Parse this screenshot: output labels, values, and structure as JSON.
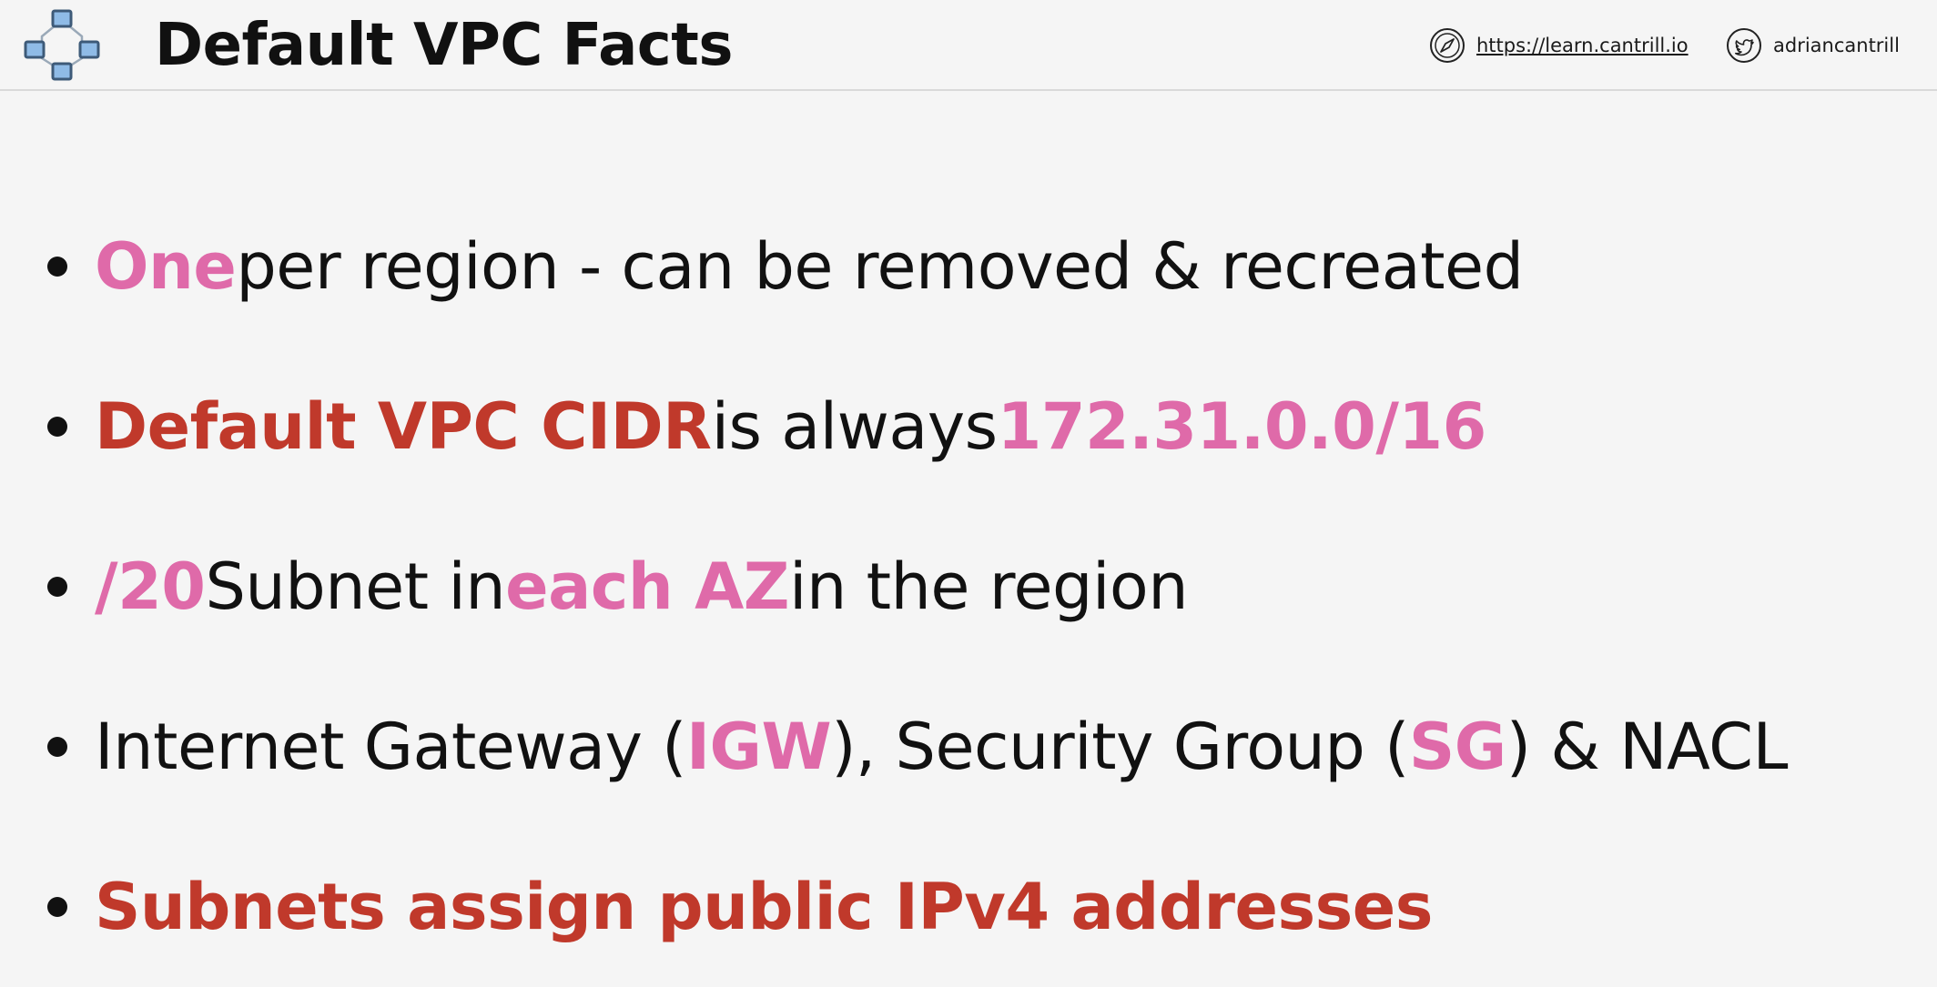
{
  "header": {
    "title": "Default VPC Facts",
    "logo_icon": "network-nodes-icon",
    "site_icon": "compass-icon",
    "site_link": "https://learn.cantrill.io",
    "twitter_icon": "twitter-bird-icon",
    "twitter_handle": "adriancantrill"
  },
  "colors": {
    "highlight_pink": "#df6aa9",
    "highlight_red": "#c0392b",
    "text": "#111111",
    "background": "#f5f5f5"
  },
  "bullets": [
    {
      "parts": [
        {
          "text": "One",
          "style": "pink"
        },
        {
          "text": " per region - can be removed & recreated",
          "style": "plain"
        }
      ]
    },
    {
      "parts": [
        {
          "text": "Default VPC CIDR",
          "style": "red"
        },
        {
          "text": " is always ",
          "style": "plain"
        },
        {
          "text": "172.31.0.0/16",
          "style": "pink"
        }
      ]
    },
    {
      "parts": [
        {
          "text": "/20",
          "style": "pink"
        },
        {
          "text": " Subnet in ",
          "style": "plain"
        },
        {
          "text": "each AZ",
          "style": "pink"
        },
        {
          "text": " in the region",
          "style": "plain"
        }
      ]
    },
    {
      "parts": [
        {
          "text": "Internet Gateway (",
          "style": "plain"
        },
        {
          "text": "IGW",
          "style": "pink"
        },
        {
          "text": "), Security Group (",
          "style": "plain"
        },
        {
          "text": "SG",
          "style": "pink"
        },
        {
          "text": ") & NACL",
          "style": "plain"
        }
      ]
    },
    {
      "parts": [
        {
          "text": "Subnets assign public IPv4 addresses",
          "style": "red"
        }
      ]
    }
  ]
}
